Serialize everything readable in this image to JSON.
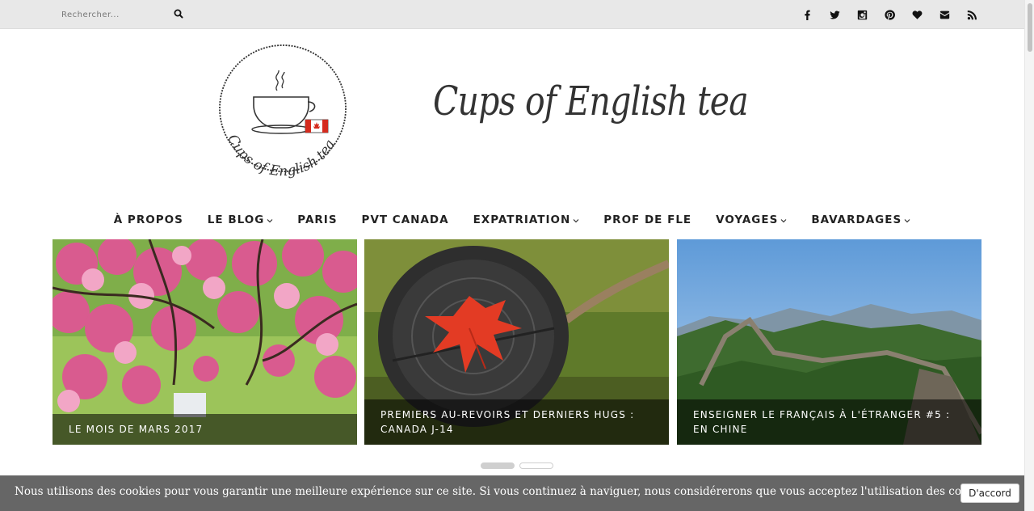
{
  "search": {
    "placeholder": "Rechercher..."
  },
  "social_icons": [
    "facebook-icon",
    "twitter-icon",
    "instagram-icon",
    "pinterest-icon",
    "heart-icon",
    "envelope-icon",
    "rss-icon"
  ],
  "header": {
    "site_title": "Cups of English tea",
    "logo_text": "Cups of English tea"
  },
  "nav": {
    "items": [
      {
        "label": "À PROPOS",
        "dropdown": false
      },
      {
        "label": "LE BLOG",
        "dropdown": true
      },
      {
        "label": "PARIS",
        "dropdown": false
      },
      {
        "label": "PVT CANADA",
        "dropdown": false
      },
      {
        "label": "EXPATRIATION",
        "dropdown": true
      },
      {
        "label": "PROF DE FLE",
        "dropdown": false
      },
      {
        "label": "VOYAGES",
        "dropdown": true
      },
      {
        "label": "BAVARDAGES",
        "dropdown": true
      }
    ]
  },
  "slider": {
    "slides": [
      {
        "caption": "LE MOIS DE MARS 2017"
      },
      {
        "caption": "PREMIERS AU-REVOIRS ET DERNIERS HUGS : CANADA J-14"
      },
      {
        "caption": "ENSEIGNER LE FRANÇAIS À L'ÉTRANGER #5 : EN CHINE"
      }
    ]
  },
  "cookie": {
    "message": "Nous utilisons des cookies pour vous garantir une meilleure expérience sur ce site. Si vous continuez à naviguer, nous considérerons que vous acceptez l'utilisation des cookies.",
    "accept_label": "D'accord"
  }
}
